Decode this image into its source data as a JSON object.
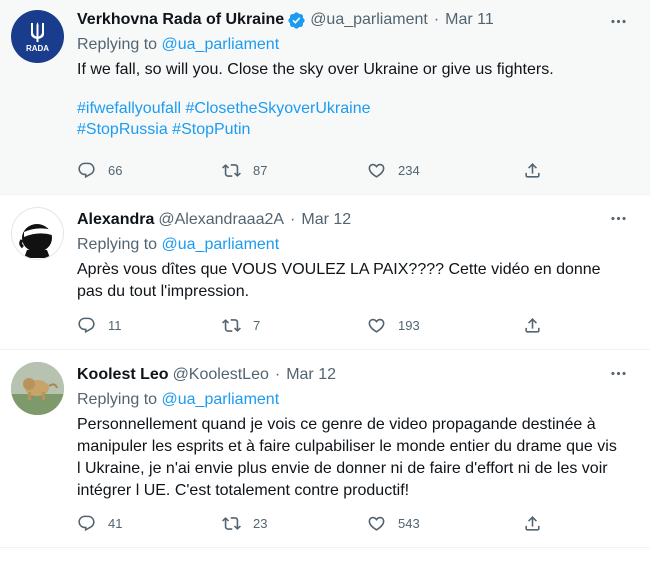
{
  "tweets": [
    {
      "name": "Verkhovna Rada of Ukraine",
      "handle": "@ua_parliament",
      "date": "Mar 11",
      "reply_prefix": "Replying to ",
      "reply_to": "@ua_parliament",
      "text": "If we fall, so will you. Close the sky over Ukraine or give us fighters.",
      "hashtags_line1": [
        "#ifwefallyoufall",
        "#ClosetheSkyoverUkraine"
      ],
      "hashtags_line2": [
        "#StopRussia",
        "#StopPutin"
      ],
      "avatar_label": "RADA",
      "replies": "66",
      "retweets": "87",
      "likes": "234"
    },
    {
      "name": "Alexandra",
      "handle": "@Alexandraaa2A",
      "date": "Mar 12",
      "reply_prefix": "Replying to ",
      "reply_to": "@ua_parliament",
      "text_lines": [
        "Après vous dîtes que VOUS VOULEZ LA PAIX???? Cette vidéo en donne",
        "pas du tout l'impression."
      ],
      "replies": "11",
      "retweets": "7",
      "likes": "193"
    },
    {
      "name": "Koolest Leo",
      "handle": "@KoolestLeo",
      "date": "Mar 12",
      "reply_prefix": "Replying to ",
      "reply_to": "@ua_parliament",
      "text_lines": [
        "Personnellement quand je vois ce genre de video propagande destinée à",
        "manipuler les esprits et à faire culpabiliser le monde entier du drame que vis",
        "l Ukraine, je n'ai envie plus envie de donner ni de faire d'effort ni de les voir",
        "intégrer l UE. C'est totalement contre productif!"
      ],
      "replies": "41",
      "retweets": "23",
      "likes": "543"
    }
  ],
  "icons": [
    "verified-badge-icon",
    "more-icon",
    "reply-icon",
    "retweet-icon",
    "like-icon",
    "share-icon"
  ],
  "colors": {
    "link": "#1d9bf0",
    "secondary": "#536471",
    "highlight_bg": "#f7f9f9",
    "rada_blue": "#1a3c8c"
  }
}
